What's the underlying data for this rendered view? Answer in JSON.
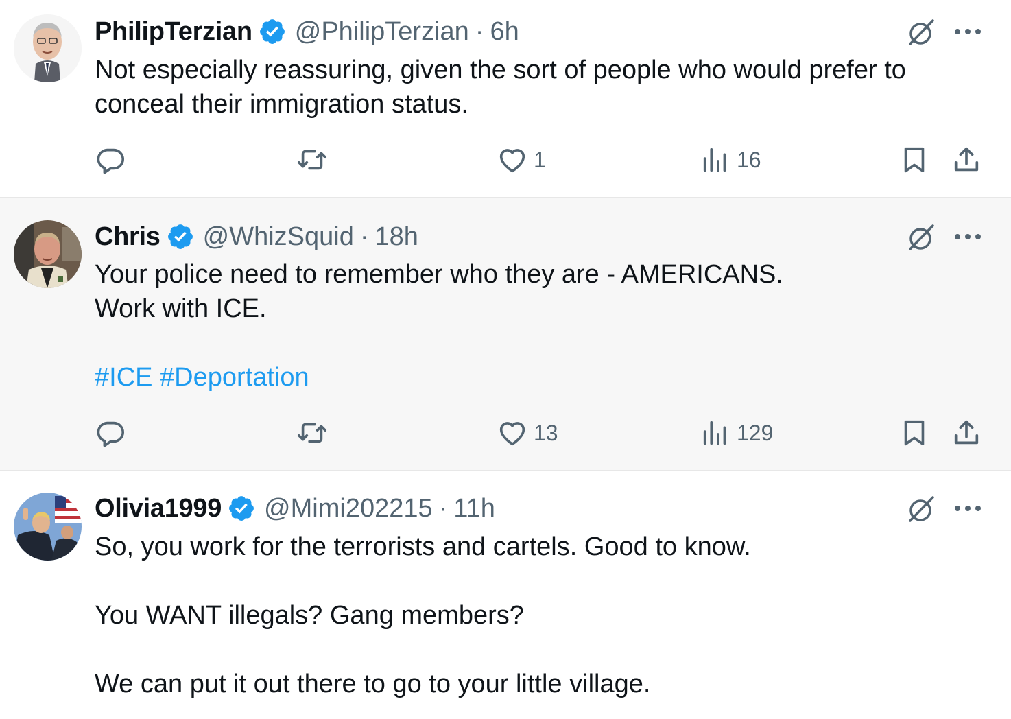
{
  "tweets": [
    {
      "name": "PhilipTerzian",
      "handle": "@PhilipTerzian",
      "separator": "·",
      "time": "6h",
      "lines": [
        "Not especially reassuring, given the sort of people who would prefer to",
        "conceal their immigration status."
      ],
      "likes": "1",
      "views": "16"
    },
    {
      "name": "Chris",
      "handle": "@WhizSquid",
      "separator": "·",
      "time": "18h",
      "lines": [
        "Your police need to remember who they are - AMERICANS.",
        "Work with ICE.",
        "",
        "#ICE #Deportation"
      ],
      "likes": "13",
      "views": "129"
    },
    {
      "name": "Olivia1999",
      "handle": "@Mimi202215",
      "separator": "·",
      "time": "11h",
      "lines": [
        "So, you work for the terrorists and cartels. Good to know.",
        "",
        "You WANT illegals? Gang members?",
        "",
        "We can put it out there to go to your little village."
      ]
    }
  ],
  "colors": {
    "accent": "#1d9bf0",
    "secondary_text": "#536471",
    "primary_text": "#0f1419",
    "highlight_background": "#f7f7f7"
  },
  "icons": [
    "verified-badge-icon",
    "grok-icon",
    "more-icon",
    "reply-icon",
    "retweet-icon",
    "like-icon",
    "views-icon",
    "bookmark-icon",
    "share-icon"
  ]
}
